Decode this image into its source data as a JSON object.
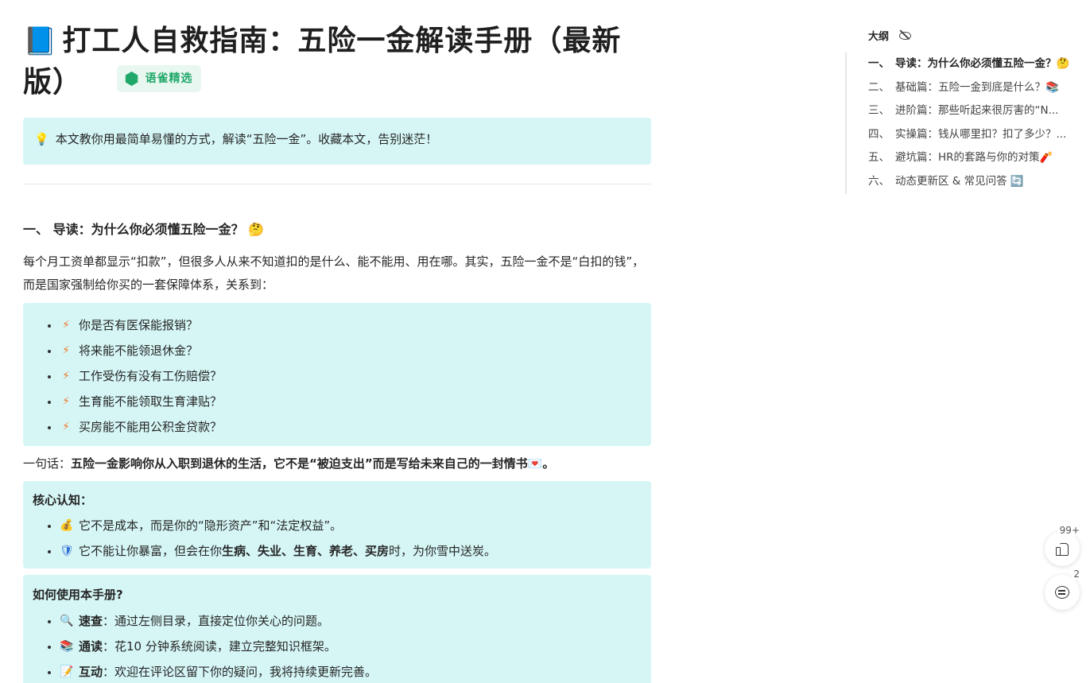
{
  "article": {
    "title_icon": "📘",
    "title": "打工人自救指南：五险一金解读手册（最新版）",
    "badge_label": "语雀精选",
    "intro_icon": "💡",
    "intro": "本文教你用最简单易懂的方式，解读“五险一金”。收藏本文，告别迷茫！",
    "section1_heading": "一、 导读：为什么你必须懂五险一金？ 🤔",
    "para1": "每个月工资单都显示“扣款”，但很多人从来不知道扣的是什么、能不能用、用在哪。其实，五险一金不是“白扣的钱”，而是国家强制给你买的一套保障体系，关系到：",
    "questions": [
      {
        "icon": "⚡",
        "text": "你是否有医保能报销？"
      },
      {
        "icon": "⚡",
        "text": "将来能不能领退休金？"
      },
      {
        "icon": "⚡",
        "text": "工作受伤有没有工伤赔偿？"
      },
      {
        "icon": "⚡",
        "text": "生育能不能领取生育津贴？"
      },
      {
        "icon": "⚡",
        "text": "买房能不能用公积金贷款？"
      }
    ],
    "oneline_prefix": "一句话：",
    "oneline_bold": "五险一金影响你从入职到退休的生活，它不是“被迫支出”而是写给未来自己的一封情书💌。",
    "core_heading": "核心认知：",
    "core_items": [
      {
        "icon": "💰",
        "text": "它不是成本，而是你的“隐形资产”和“法定权益”。"
      },
      {
        "icon": "🛡",
        "text_before": "它不能让你暴富，但会在你",
        "text_bold": "生病、失业、生育、养老、买房",
        "text_after": "时，为你雪中送炭。"
      }
    ],
    "usage_heading": "如何使用本手册?",
    "usage_items": [
      {
        "icon": "🔍",
        "bold": "速查",
        "text": "：通过左侧目录，直接定位你关心的问题。"
      },
      {
        "icon": "📚",
        "bold": "通读",
        "text": "：花10 分钟系统阅读，建立完整知识框架。"
      },
      {
        "icon": "📝",
        "bold": "互动",
        "text": "：欢迎在评论区留下你的疑问，我将持续更新完善。"
      }
    ]
  },
  "outline": {
    "heading": "大纲",
    "items": [
      {
        "num": "一、",
        "text": "导读：为什么你必须懂五险一金？🤔"
      },
      {
        "num": "二、",
        "text": "基础篇：五险一金到底是什么？📚"
      },
      {
        "num": "三、",
        "text": "进阶篇：那些听起来很厉害的“N..."
      },
      {
        "num": "四、",
        "text": "实操篇：钱从哪里扣？扣了多少？..."
      },
      {
        "num": "五、",
        "text": "避坑篇：HR的套路与你的对策🧨"
      },
      {
        "num": "六、",
        "text": "动态更新区 & 常见问答 🔄"
      }
    ]
  },
  "floating": {
    "like_count": "99+",
    "comment_count": "2"
  },
  "colors": {
    "callout_bg": "#d6f6f6",
    "badge_green": "#1fa86a"
  }
}
